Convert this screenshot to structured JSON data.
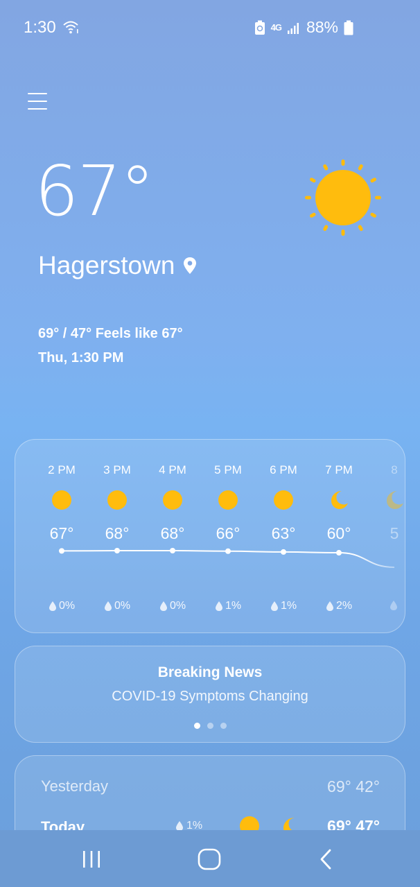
{
  "status_bar": {
    "time": "1:30",
    "network": "4G",
    "battery": "88%"
  },
  "icons": {
    "menu": "menu-icon",
    "condition": "sun-icon",
    "location": "location-pin-icon"
  },
  "current": {
    "temperature": "67°",
    "location": "Hagerstown",
    "hi_lo_feels": "69° / 47° Feels like 67°",
    "datetime": "Thu, 1:30 PM"
  },
  "hourly": [
    {
      "time": "2 PM",
      "icon": "sun",
      "temp": "67°",
      "rain": "0%"
    },
    {
      "time": "3 PM",
      "icon": "sun",
      "temp": "68°",
      "rain": "0%"
    },
    {
      "time": "4 PM",
      "icon": "sun",
      "temp": "68°",
      "rain": "0%"
    },
    {
      "time": "5 PM",
      "icon": "sun",
      "temp": "66°",
      "rain": "1%"
    },
    {
      "time": "6 PM",
      "icon": "sun",
      "temp": "63°",
      "rain": "1%"
    },
    {
      "time": "7 PM",
      "icon": "moon",
      "temp": "60°",
      "rain": "2%"
    },
    {
      "time": "8",
      "icon": "moon",
      "temp": "5",
      "rain": ""
    }
  ],
  "news": {
    "title": "Breaking News",
    "headline": "COVID-19 Symptoms Changing",
    "page_count": 3,
    "active_page": 1
  },
  "daily": {
    "yesterday": {
      "label": "Yesterday",
      "temps": "69° 42°"
    },
    "today": {
      "label": "Today",
      "rain": "1%",
      "temps": "69° 47°"
    }
  },
  "colors": {
    "sun": "#ffbc0d",
    "background_top": "#82a6e2",
    "background_bottom": "#6b9fdb"
  }
}
